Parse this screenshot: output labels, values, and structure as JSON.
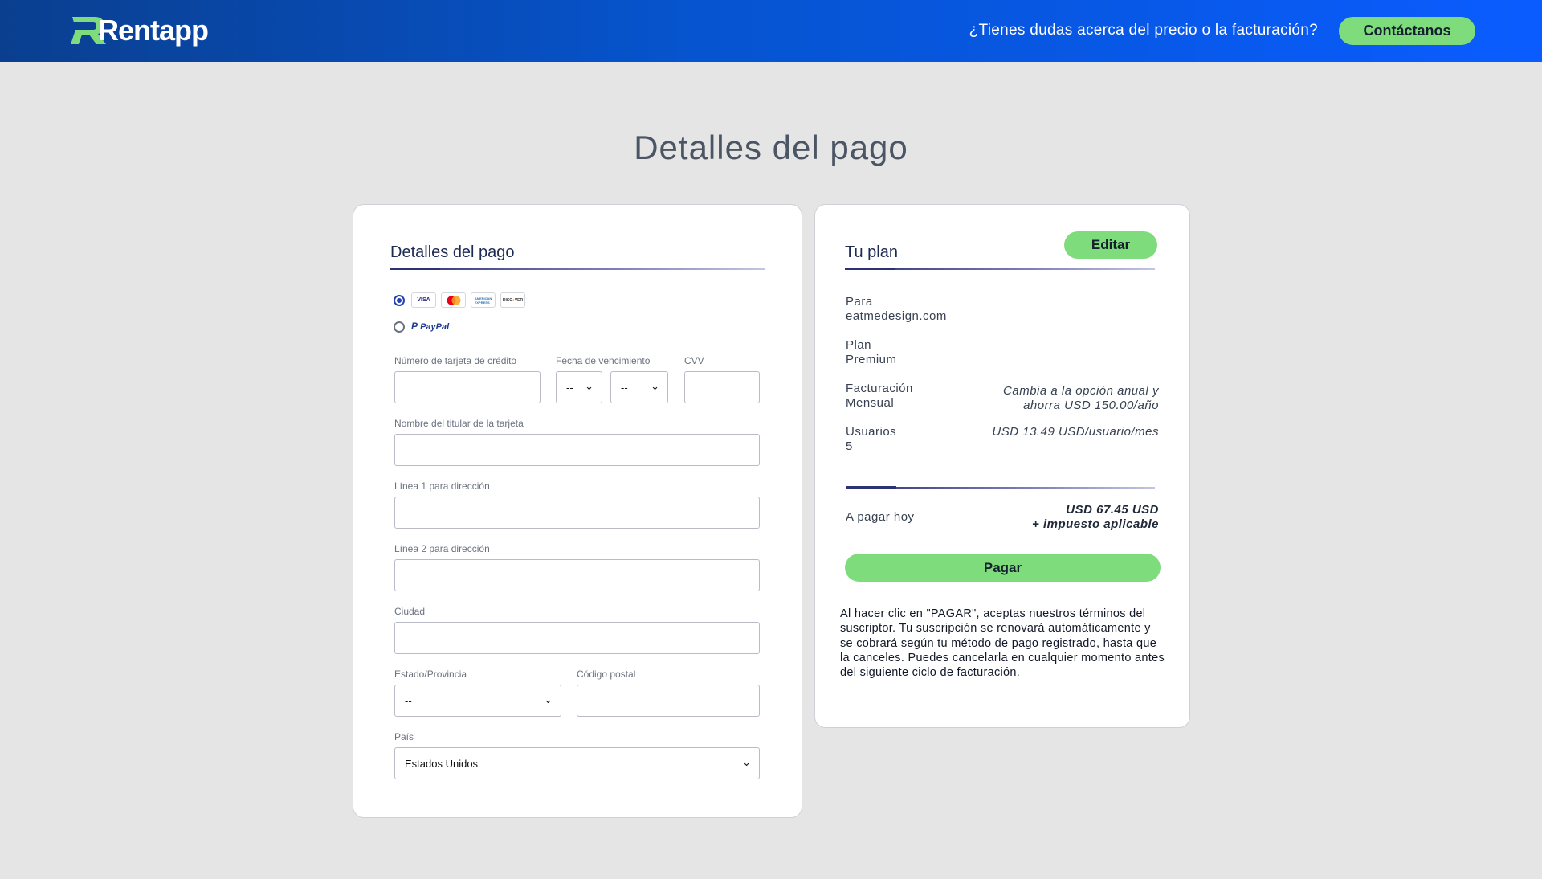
{
  "header": {
    "logo_text": "Rentapp",
    "question": "¿Tienes dudas acerca del precio o la facturación?",
    "contact_label": "Contáctanos"
  },
  "page": {
    "title": "Detalles del pago"
  },
  "payment": {
    "section_title": "Detalles del pago",
    "options": [
      {
        "type": "card",
        "selected": true,
        "brands": [
          "VISA",
          "mastercard",
          "AMERICAN EXPRESS",
          "DISCOVER"
        ]
      },
      {
        "type": "paypal",
        "selected": false,
        "label": "PayPal"
      }
    ],
    "fields": {
      "card_number": {
        "label": "Número de tarjeta de crédito",
        "value": ""
      },
      "expiry": {
        "label": "Fecha de vencimiento",
        "month": "--",
        "year": "--"
      },
      "cvv": {
        "label": "CVV",
        "value": ""
      },
      "holder": {
        "label": "Nombre del titular de la tarjeta",
        "value": ""
      },
      "address1": {
        "label": "Línea 1 para dirección",
        "value": ""
      },
      "address2": {
        "label": "Línea 2 para dirección",
        "value": ""
      },
      "city": {
        "label": "Ciudad",
        "value": ""
      },
      "state": {
        "label": "Estado/Provincia",
        "value": "--"
      },
      "zip": {
        "label": "Código postal",
        "value": ""
      },
      "country": {
        "label": "País",
        "value": "Estados Unidos"
      }
    }
  },
  "plan": {
    "section_title": "Tu plan",
    "edit_label": "Editar",
    "rows": [
      {
        "label": "Para",
        "value": "eatmedesign.com",
        "note": ""
      },
      {
        "label": "Plan",
        "value": "Premium",
        "note": ""
      },
      {
        "label": "Facturación",
        "value": "Mensual",
        "note_line1": "Cambia a la opción anual y",
        "note_line2": "ahorra USD 150.00/año"
      },
      {
        "label": "Usuarios",
        "value": "5",
        "note": "USD 13.49 USD/usuario/mes"
      }
    ],
    "total": {
      "label": "A pagar hoy",
      "amount": "USD 67.45 USD",
      "tax": "+ impuesto aplicable"
    },
    "pay_label": "Pagar",
    "legal": "Al hacer clic en \"PAGAR\", aceptas nuestros términos del suscriptor. Tu suscripción se renovará automáticamente y se cobrará según tu método de pago registrado, hasta que la canceles. Puedes cancelarla en cualquier momento antes del siguiente ciclo de facturación."
  },
  "colors": {
    "header_start": "#0a3f8f",
    "header_end": "#0a5cff",
    "accent_green": "#7fdc7c",
    "radio_selected": "#2541b2",
    "background": "#e5e5e5"
  },
  "icons": [
    "rentapp-logo",
    "visa-icon",
    "mastercard-icon",
    "amex-icon",
    "discover-icon",
    "paypal-icon",
    "chevron-down-icon"
  ]
}
